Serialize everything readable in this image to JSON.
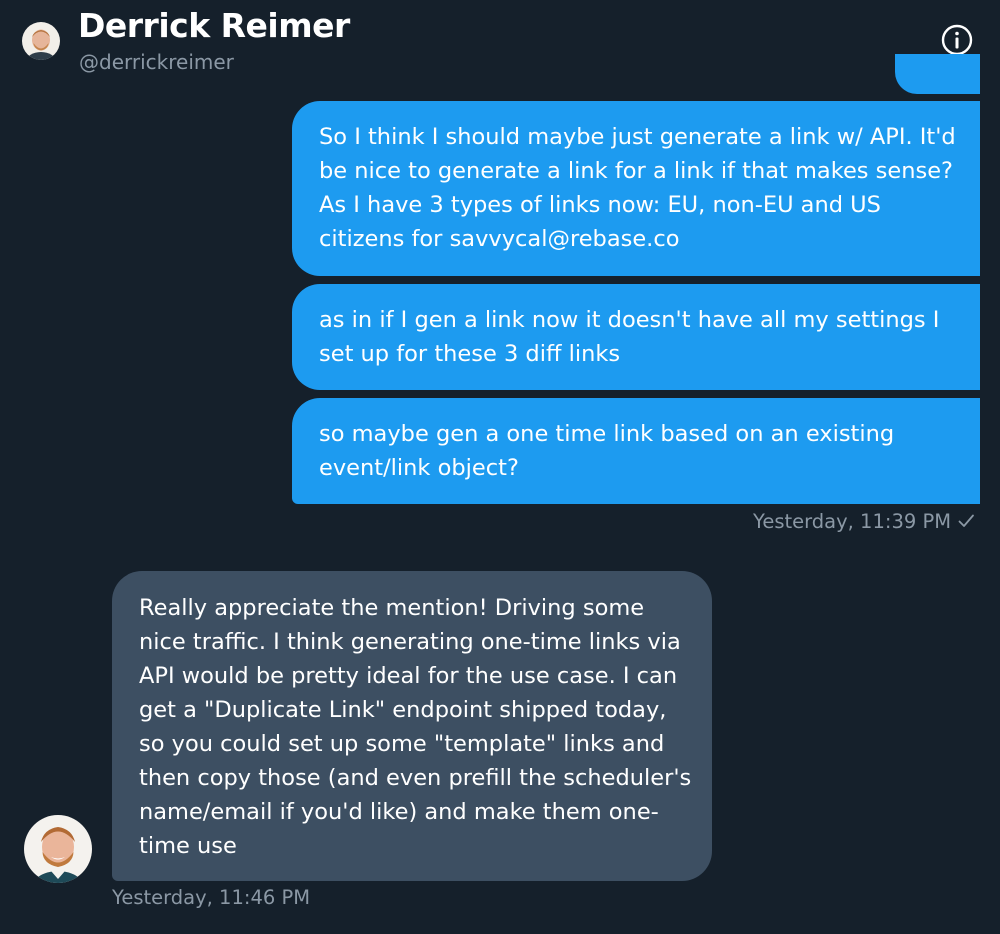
{
  "header": {
    "name": "Derrick Reimer",
    "handle": "@derrickreimer"
  },
  "messages_outgoing": [
    {
      "text": "So I think I should maybe just generate a link w/ API. It'd be nice to generate a link for a link if that makes sense? As I have 3 types of links now: EU, non-EU and US citizens for savvycal@rebase.co"
    },
    {
      "text": "as in if I gen a link now it doesn't have all my settings I set up for these 3 diff links"
    },
    {
      "text": "so maybe gen a one time link based on an existing event/link object?"
    }
  ],
  "outgoing_timestamp": "Yesterday, 11:39 PM",
  "message_incoming": {
    "text": "Really appreciate the mention! Driving some nice traffic. I think generating one-time links via API would be pretty ideal for the use case. I can get a \"Duplicate Link\" endpoint shipped today, so you could set up some \"template\" links and then copy those (and even prefill the scheduler's name/email if you'd like) and make them one-time use",
    "timestamp": "Yesterday, 11:46 PM"
  },
  "colors": {
    "background": "#15202b",
    "outgoing_bubble": "#1d9bf0",
    "incoming_bubble": "#3d4f62",
    "secondary_text": "#8b98a5"
  },
  "icons": {
    "info": "info-circle-icon",
    "read_receipt": "checkmark-icon"
  }
}
